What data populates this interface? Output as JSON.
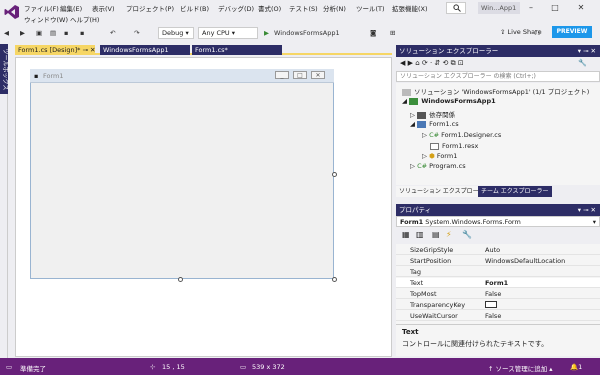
{
  "menu": {
    "row1": [
      "ファイル(F)",
      "編集(E)",
      "表示(V)",
      "プロジェクト(P)",
      "ビルド(B)",
      "デバッグ(D)",
      "書式(O)",
      "テスト(S)",
      "分析(N)",
      "ツール(T)",
      "拡張機能(X)"
    ],
    "row2": [
      "ウィンドウ(W)",
      "ヘルプ(H)"
    ]
  },
  "title": {
    "text": "Win...App1"
  },
  "toolbar": {
    "config": "Debug",
    "platform": "Any CPU",
    "run_label": "WindowsFormsApp1",
    "live_share": "Live Share",
    "preview": "PREVIEW"
  },
  "toolbox": {
    "label": "ツールボックス"
  },
  "doc_tabs": [
    "Form1.cs [Design]*",
    "WindowsFormsApp1",
    "Form1.cs*"
  ],
  "form": {
    "title": "Form1"
  },
  "solution_explorer": {
    "title": "ソリューション エクスプローラー",
    "search_placeholder": "ソリューション エクスプローラー の検索 (Ctrl+;)",
    "items": [
      "ソリューション 'WindowsFormsApp1' (1/1 プロジェクト)",
      "WindowsFormsApp1",
      "依存関係",
      "Form1.cs",
      "Form1.Designer.cs",
      "Form1.resx",
      "Form1",
      "Program.cs"
    ],
    "bottom_tabs": [
      "ソリューション エクスプローラー",
      "チーム エクスプローラー"
    ]
  },
  "properties": {
    "title": "プロパティ",
    "object_name": "Form1",
    "object_type": "System.Windows.Forms.Form",
    "rows": [
      {
        "name": "SizeGripStyle",
        "value": "Auto"
      },
      {
        "name": "StartPosition",
        "value": "WindowsDefaultLocation"
      },
      {
        "name": "Tag",
        "value": ""
      },
      {
        "name": "Text",
        "value": "Form1"
      },
      {
        "name": "TopMost",
        "value": "False"
      },
      {
        "name": "TransparencyKey",
        "value": ""
      },
      {
        "name": "UseWaitCursor",
        "value": "False"
      }
    ],
    "desc_title": "Text",
    "desc_text": "コントロールに関連付けられたテキストです。"
  },
  "status": {
    "ready": "準備完了",
    "position": "15 , 15",
    "size": "539 x 372",
    "source_control": "ソース管理に追加",
    "notifications": "1"
  },
  "colors": {
    "status_bar": "#68217a",
    "active_tab": "#f6d665",
    "tool_header": "#2d2d66"
  }
}
